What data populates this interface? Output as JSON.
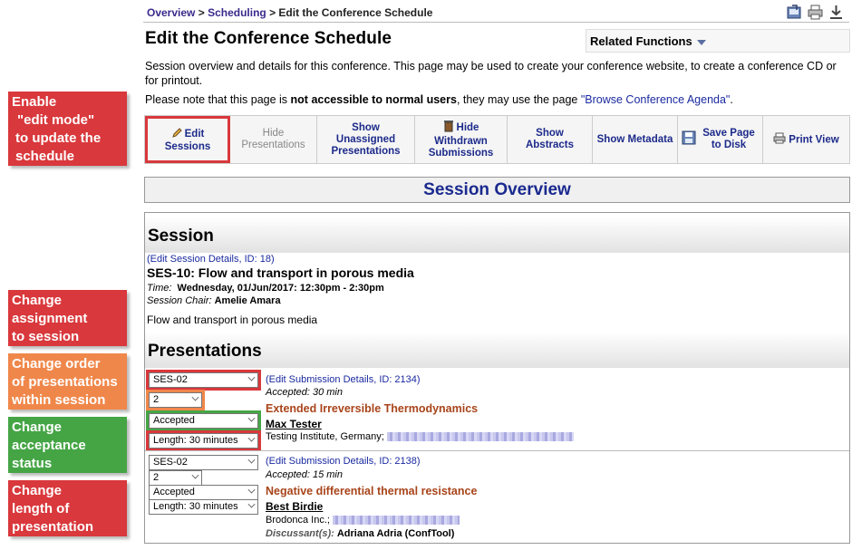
{
  "callouts": [
    {
      "lines": [
        "Enable",
        "\"edit mode\"",
        "to update the",
        "schedule"
      ]
    },
    {
      "lines": [
        "Change",
        "assignment",
        "to session"
      ]
    },
    {
      "lines": [
        "Change order",
        "of presentations",
        "within session"
      ]
    },
    {
      "lines": [
        "Change",
        "acceptance",
        "status"
      ]
    },
    {
      "lines": [
        "Change",
        "length of",
        "presentation"
      ]
    }
  ],
  "breadcrumb": {
    "overview": "Overview",
    "sep1": " > ",
    "scheduling": "Scheduling",
    "sep2": " > ",
    "current": "Edit the Conference Schedule"
  },
  "top_icons": [
    "export-icon",
    "print-icon",
    "download-icon"
  ],
  "page_title": "Edit the Conference Schedule",
  "related_functions": "Related Functions",
  "intro": "Session overview and details for this conference. This page may be used to create your conference website, to create a conference CD or for printout.",
  "note": {
    "pre": "Please note that this page is ",
    "bold": "not accessible to normal users",
    "mid": ", they may use the page ",
    "link": "\"Browse Conference Agenda\"",
    "post": "."
  },
  "toolbar": {
    "edit_sessions": "Edit Sessions",
    "hide_presentations": "Hide Presentations",
    "show_unassigned": "Show Unassigned Presentations",
    "hide_withdrawn": "Hide Withdrawn Submissions",
    "show_abstracts": "Show Abstracts",
    "show_metadata": "Show Metadata",
    "save_page": "Save Page to Disk",
    "print_view": "Print View"
  },
  "overview_heading": "Session Overview",
  "session": {
    "heading": "Session",
    "edit_link": "(Edit Session Details, ID: 18)",
    "code_title": "SES-10: Flow and transport in porous media",
    "time_label": "Time:",
    "time_value": "Wednesday, 01/Jun/2017: 12:30pm - 2:30pm",
    "chair_label": "Session Chair:",
    "chair_value": "Amelie Amara",
    "description": "Flow and transport in porous media"
  },
  "presentations_heading": "Presentations",
  "presentations": [
    {
      "session_select": "SES-02",
      "order_select": "2",
      "acceptance_select": "Accepted",
      "length_select": "Length: 30 minutes",
      "edit_link": "(Edit Submission Details, ID: 2134)",
      "accepted_info": "Accepted: 30 min",
      "title": "Extended Irreversible Thermodynamics",
      "author": "Max Tester",
      "affiliation": "Testing Institute, Germany;"
    },
    {
      "session_select": "SES-02",
      "order_select": "2",
      "acceptance_select": "Accepted",
      "length_select": "Length: 30 minutes",
      "edit_link": "(Edit Submission Details, ID: 2138)",
      "accepted_info": "Accepted: 15 min",
      "title": "Negative differential thermal resistance",
      "author": "Best Birdie",
      "affiliation": "Brodonca Inc.;",
      "discussant_label": "Discussant(s):",
      "discussant_value": "Adriana Adria (ConfTool)"
    }
  ],
  "colors": {
    "red": "#d9383c",
    "orange": "#f0874a",
    "green": "#45a545",
    "link": "#1c2a8a",
    "title_brown": "#a8441a"
  }
}
